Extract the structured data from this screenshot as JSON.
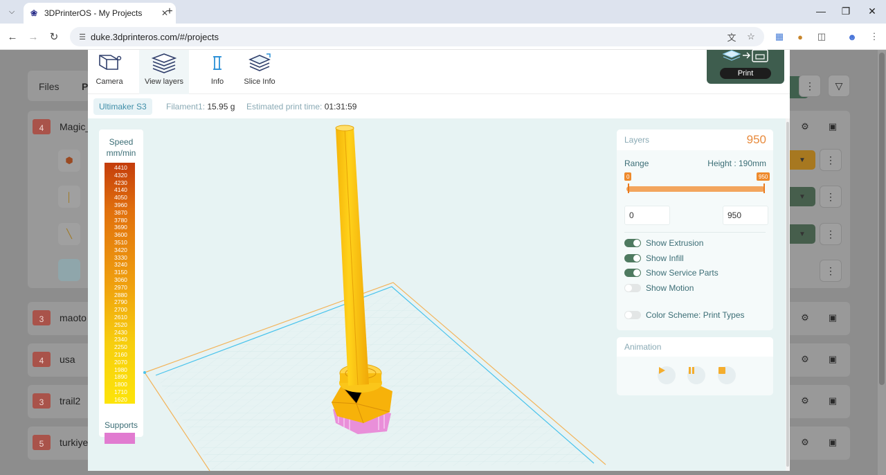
{
  "browser": {
    "tab_title": "3DPrinterOS - My Projects",
    "url": "duke.3dprinteros.com/#/projects"
  },
  "background": {
    "tabs": [
      "Files",
      "P"
    ],
    "rows": [
      {
        "badge": "4",
        "name": "Magic_"
      },
      {
        "badge": "3",
        "name": "maoto"
      },
      {
        "badge": "4",
        "name": "usa"
      },
      {
        "badge": "3",
        "name": "trail2"
      },
      {
        "badge": "5",
        "name": "turkiye"
      }
    ]
  },
  "modal": {
    "tools": [
      {
        "label": "Camera",
        "icon": "camera-cube-icon"
      },
      {
        "label": "View layers",
        "icon": "layers-stack-icon"
      },
      {
        "label": "Info",
        "icon": "info-icon"
      },
      {
        "label": "Slice Info",
        "icon": "slice-info-icon"
      }
    ],
    "print_label": "Print",
    "printer": "Ultimaker S3",
    "filament_label": "Filament1:",
    "filament_value": "15.95 g",
    "time_label": "Estimated print time:",
    "time_value": "01:31:59"
  },
  "speed_legend": {
    "title_line1": "Speed",
    "title_line2": "mm/min",
    "values": [
      "4410",
      "4320",
      "4230",
      "4140",
      "4050",
      "3960",
      "3870",
      "3780",
      "3690",
      "3600",
      "3510",
      "3420",
      "3330",
      "3240",
      "3150",
      "3060",
      "2970",
      "2880",
      "2790",
      "2700",
      "2610",
      "2520",
      "2430",
      "2340",
      "2250",
      "2160",
      "2070",
      "1980",
      "1890",
      "1800",
      "1710",
      "1620"
    ],
    "supports_label": "Supports",
    "supports_color": "#e17bd0"
  },
  "layers": {
    "title": "Layers",
    "count": "950",
    "range_label": "Range",
    "height_label": "Height : 190mm",
    "range_min_flag": "0",
    "range_max_flag": "950",
    "min_value": "0",
    "max_value": "950",
    "toggles": [
      {
        "label": "Show Extrusion",
        "on": true
      },
      {
        "label": "Show Infill",
        "on": true
      },
      {
        "label": "Show Service Parts",
        "on": true
      },
      {
        "label": "Show Motion",
        "on": false
      },
      {
        "label": "Color Scheme: Print Types",
        "on": false
      }
    ]
  },
  "animation": {
    "title": "Animation",
    "buttons": [
      "play-icon",
      "pause-icon",
      "stop-icon"
    ]
  },
  "colors": {
    "accent_orange": "#ee8a2c",
    "toggle_on": "#4e7a60",
    "print_box": "#3e5d4e",
    "model_yellow": "#fcc40d"
  }
}
